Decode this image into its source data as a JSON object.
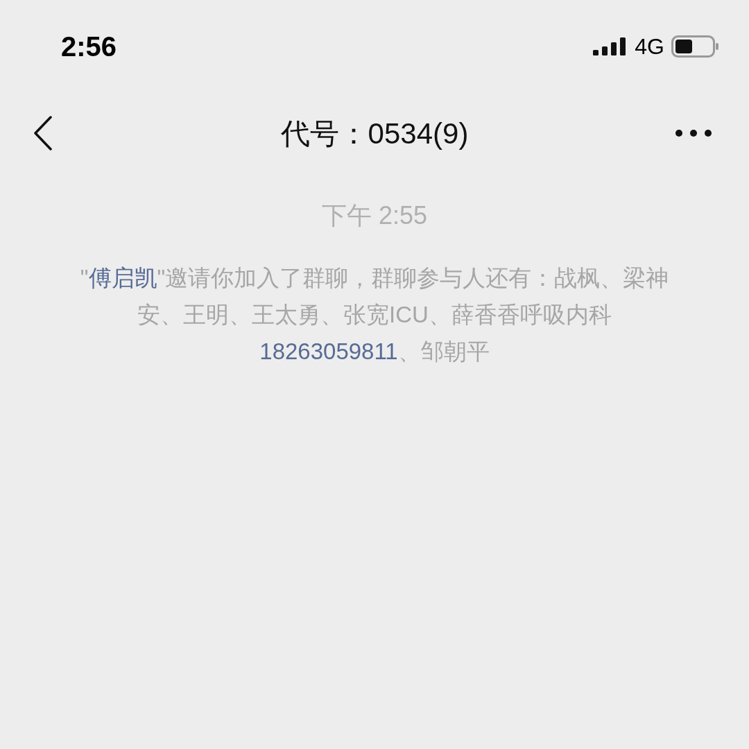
{
  "status_bar": {
    "time": "2:56",
    "network": "4G"
  },
  "header": {
    "title": "代号：0534(9)"
  },
  "messages": [
    {
      "kind": "timestamp",
      "text": "下午 2:55"
    },
    {
      "kind": "system",
      "segments": [
        {
          "kind": "plain",
          "text": "\""
        },
        {
          "kind": "link",
          "text": "傅启凯"
        },
        {
          "kind": "plain",
          "text": "\"邀请你加入了群聊，群聊参与人还有：战枫、梁神安、王明、王太勇、张宽ICU、薛香香呼吸内科"
        },
        {
          "kind": "link",
          "text": "18263059811"
        },
        {
          "kind": "plain",
          "text": "、邹朝平"
        }
      ]
    }
  ]
}
